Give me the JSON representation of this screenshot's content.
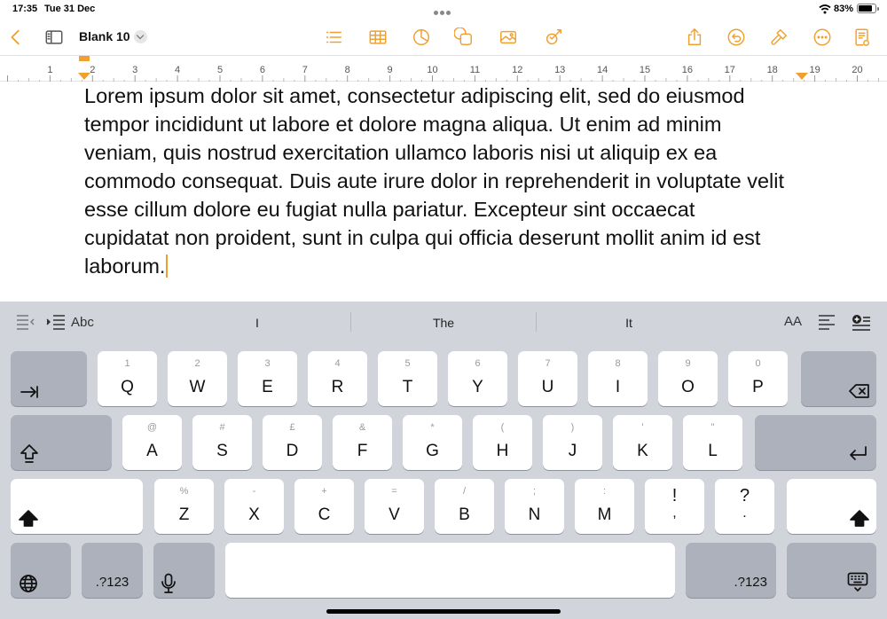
{
  "status_bar": {
    "time": "17:35",
    "date": "Tue 31 Dec",
    "battery": "83%"
  },
  "toolbar": {
    "doc_title": "Blank 10",
    "left_icons": [
      "back-chevron-icon",
      "sidebar-icon"
    ],
    "center_icons": [
      "list-icon",
      "table-icon",
      "chart-icon",
      "shapes-icon",
      "media-icon",
      "smart-annotation-icon"
    ],
    "right_icons": [
      "share-icon",
      "undo-icon",
      "format-brush-icon",
      "more-icon",
      "document-setup-icon"
    ],
    "accent_color": "#f0a030"
  },
  "ruler": {
    "numbers": [
      "1",
      "2",
      "3",
      "4",
      "5",
      "6",
      "7",
      "8",
      "9",
      "10",
      "11",
      "12",
      "13",
      "14",
      "15",
      "16",
      "17",
      "18",
      "19",
      "20"
    ]
  },
  "document": {
    "body": "Lorem ipsum dolor sit amet, consectetur adipiscing elit, sed do eiusmod tempor incididunt ut labore et dolore magna aliqua. Ut enim ad minim veniam, quis nostrud exercitation ullamco laboris nisi ut aliquip ex ea commodo consequat. Duis aute irure dolor in reprehenderit in voluptate velit esse cillum dolore eu fugiat nulla pariatur. Excepteur sint occaecat cupidatat non proident, sunt in culpa qui officia deserunt mollit anim id est laborum."
  },
  "keyboard": {
    "style_label": "Abc",
    "suggestions": [
      "I",
      "The",
      "It"
    ],
    "font_size_label": "AA",
    "row1": [
      {
        "main": "Q",
        "sub": "1"
      },
      {
        "main": "W",
        "sub": "2"
      },
      {
        "main": "E",
        "sub": "3"
      },
      {
        "main": "R",
        "sub": "4"
      },
      {
        "main": "T",
        "sub": "5"
      },
      {
        "main": "Y",
        "sub": "6"
      },
      {
        "main": "U",
        "sub": "7"
      },
      {
        "main": "I",
        "sub": "8"
      },
      {
        "main": "O",
        "sub": "9"
      },
      {
        "main": "P",
        "sub": "0"
      }
    ],
    "row2": [
      {
        "main": "A",
        "sub": "@"
      },
      {
        "main": "S",
        "sub": "#"
      },
      {
        "main": "D",
        "sub": "£"
      },
      {
        "main": "F",
        "sub": "&"
      },
      {
        "main": "G",
        "sub": "*"
      },
      {
        "main": "H",
        "sub": "("
      },
      {
        "main": "J",
        "sub": ")"
      },
      {
        "main": "K",
        "sub": "'"
      },
      {
        "main": "L",
        "sub": "\""
      }
    ],
    "row3": [
      {
        "main": "Z",
        "sub": "%"
      },
      {
        "main": "X",
        "sub": "-"
      },
      {
        "main": "C",
        "sub": "+"
      },
      {
        "main": "V",
        "sub": "="
      },
      {
        "main": "B",
        "sub": "/"
      },
      {
        "main": "N",
        "sub": ";"
      },
      {
        "main": "M",
        "sub": ":"
      },
      {
        "main": ",",
        "sub": "!"
      },
      {
        "main": ".",
        "sub": "?"
      }
    ],
    "numbers_label": ".?123"
  }
}
